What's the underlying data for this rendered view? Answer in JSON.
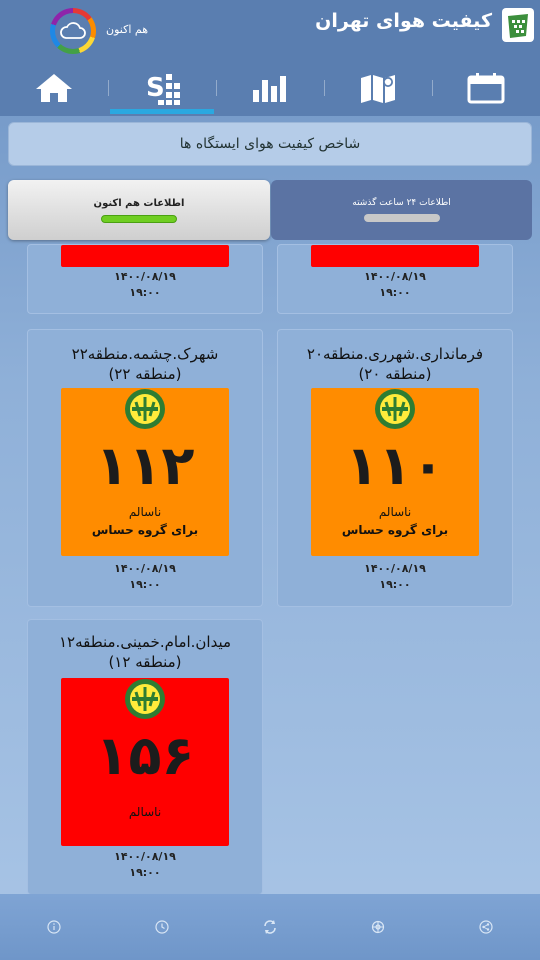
{
  "header": {
    "app_title": "کیفیت هوای تهران",
    "now_label": "هم اکنون"
  },
  "nav": {
    "items": [
      {
        "icon": "calendar-icon"
      },
      {
        "icon": "map-icon"
      },
      {
        "icon": "bar-chart-icon"
      },
      {
        "icon": "index-icon"
      },
      {
        "icon": "home-icon"
      }
    ],
    "active_index": 3
  },
  "index_bar": {
    "title": "شاخص کیفیت هوای ایستگاه ها"
  },
  "tabs": {
    "now": {
      "label": "اطلاعات هم اکنون",
      "active": true
    },
    "past24": {
      "label": "اطلاعات ۲۴ ساعت گذشته",
      "active": false
    }
  },
  "stations": [
    {
      "name": "",
      "zone": "",
      "aqi": "",
      "status_line1": "",
      "status_line2": "",
      "date": "۱۴۰۰/۰۸/۱۹",
      "time": "۱۹:۰۰",
      "color": "#ff0000"
    },
    {
      "name": "",
      "zone": "",
      "aqi": "",
      "status_line1": "",
      "status_line2": "",
      "date": "۱۴۰۰/۰۸/۱۹",
      "time": "۱۹:۰۰",
      "color": "#ff0000"
    },
    {
      "name": "فرمانداری.شهرری.منطقه۲۰",
      "zone": "(منطقه ۲۰)",
      "aqi": "۱۱۰",
      "status_line1": "ناسالم",
      "status_line2": "برای گروه حساس",
      "date": "۱۴۰۰/۰۸/۱۹",
      "time": "۱۹:۰۰",
      "color": "#ff8c00"
    },
    {
      "name": "شهرک.چشمه.منطقه۲۲",
      "zone": "(منطقه ۲۲)",
      "aqi": "۱۱۲",
      "status_line1": "ناسالم",
      "status_line2": "برای گروه حساس",
      "date": "۱۴۰۰/۰۸/۱۹",
      "time": "۱۹:۰۰",
      "color": "#ff8c00"
    },
    {
      "name": "میدان.امام.خمینی.منطقه۱۲",
      "zone": "(منطقه ۱۲)",
      "aqi": "۱۵۶",
      "status_line1": "ناسالم",
      "status_line2": "",
      "date": "۱۴۰۰/۰۸/۱۹",
      "time": "۱۹:۰۰",
      "color": "#ff0000"
    }
  ],
  "bottom_bar": {
    "icons": [
      "info-icon",
      "clock-icon",
      "refresh-icon",
      "settings-icon",
      "share-icon"
    ]
  },
  "colors": {
    "header_bg": "#5a7eb0",
    "active_tab_indicator": "#2aa8e0",
    "now_indicator": "#6fce22",
    "unhealthy_sensitive": "#ff8c00",
    "unhealthy": "#ff0000"
  }
}
